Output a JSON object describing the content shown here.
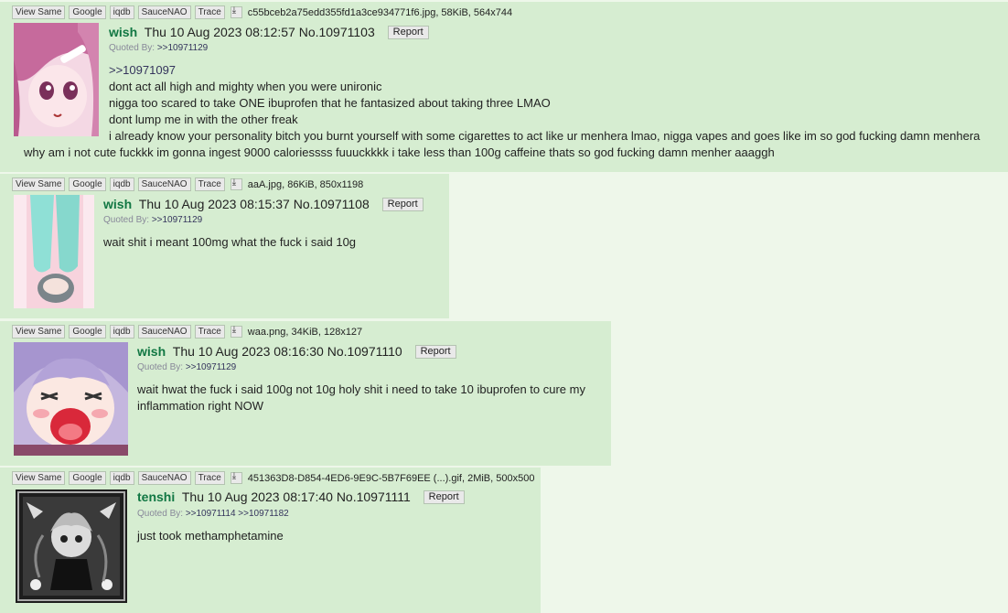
{
  "buttons": {
    "view_same": "View Same",
    "google": "Google",
    "iqdb": "iqdb",
    "saucenao": "SauceNAO",
    "trace": "Trace",
    "report": "Report",
    "quoted_by": "Quoted By:"
  },
  "posts": [
    {
      "file": "c55bceb2a75edd355fd1a3ce934771f6.jpg, 58KiB, 564x744",
      "name": "wish",
      "date": "Thu 10 Aug 2023 08:12:57",
      "number": "No.10971103",
      "quoted_by": ">>10971129",
      "lines": [
        ">>10971097",
        "dont act all high and mighty when you were unironic",
        "nigga too scared to take ONE ibuprofen that he fantasized about taking three LMAO",
        "dont lump me in with the other freak",
        "i already know your personality bitch you burnt yourself with some cigarettes to act like ur menhera lmao, nigga vapes and goes like im so god fucking damn menhera",
        "why am i not cute fuckkk im gonna ingest 9000 caloriessss fuuuckkkk i take less than 100g caffeine thats so god fucking damn menher aaaggh"
      ]
    },
    {
      "file": "aaA.jpg, 86KiB, 850x1198",
      "name": "wish",
      "date": "Thu 10 Aug 2023 08:15:37",
      "number": "No.10971108",
      "quoted_by": ">>10971129",
      "lines": [
        "wait shit i meant 100mg what the fuck i said 10g"
      ]
    },
    {
      "file": "waa.png, 34KiB, 128x127",
      "name": "wish",
      "date": "Thu 10 Aug 2023 08:16:30",
      "number": "No.10971110",
      "quoted_by": ">>10971129",
      "lines": [
        "wait hwat the fuck i said 100g not 10g holy shit i need to take 10 ibuprofen to cure my",
        "inflammation right NOW"
      ]
    },
    {
      "file": "451363D8-D854-4ED6-9E9C-5B7F69EE (...).gif, 2MiB, 500x500",
      "name": "tenshi",
      "date": "Thu 10 Aug 2023 08:17:40",
      "number": "No.10971111",
      "quoted_by_1": ">>10971114",
      "quoted_by_2": ">>10971182",
      "lines": [
        "just took methamphetamine"
      ]
    }
  ]
}
